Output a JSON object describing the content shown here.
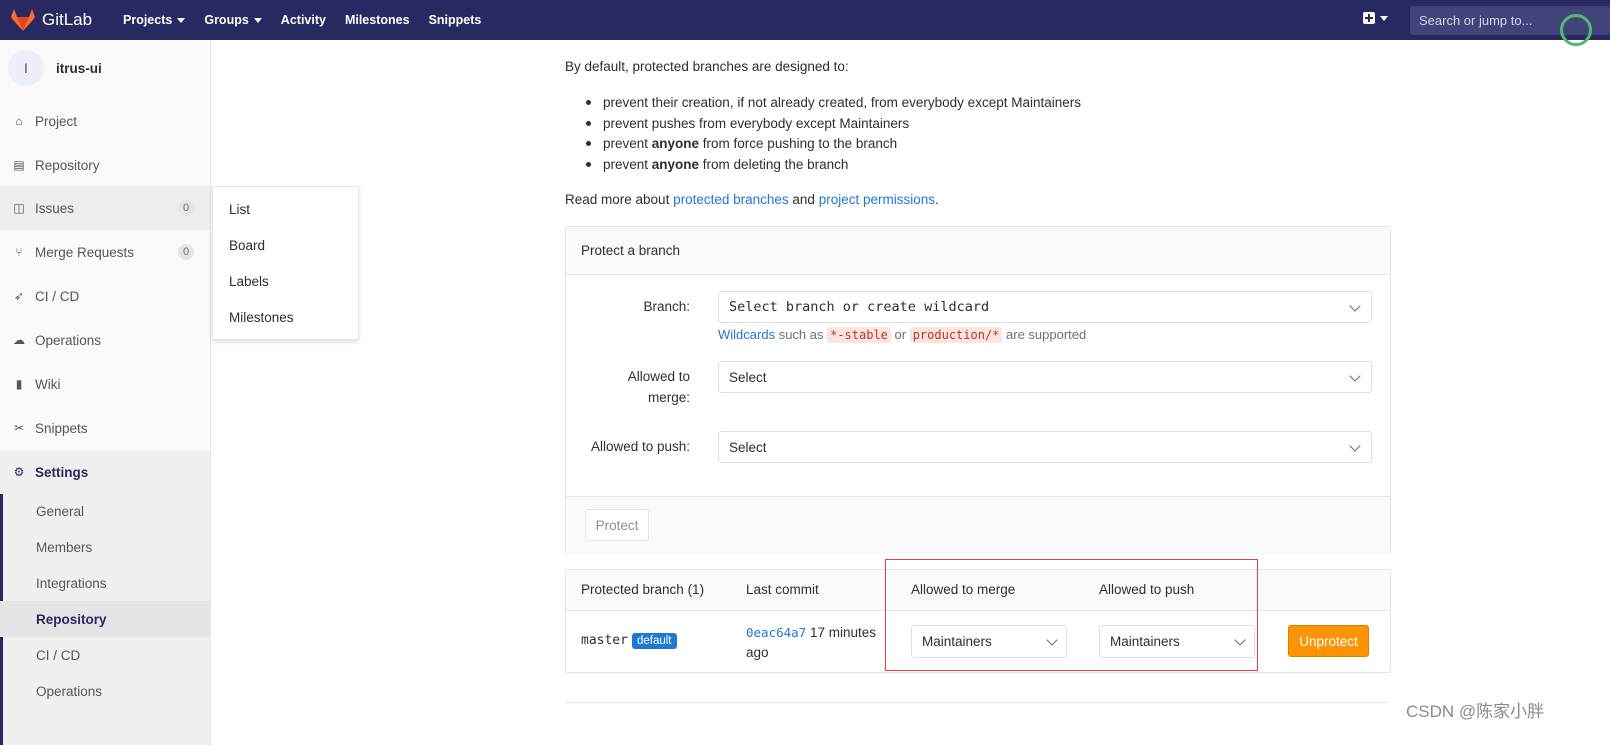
{
  "topbar": {
    "brand": "GitLab",
    "nav": [
      "Projects",
      "Groups",
      "Activity",
      "Milestones",
      "Snippets"
    ],
    "search_placeholder": "Search or jump to..."
  },
  "sidebar": {
    "project_initial": "I",
    "project_name": "itrus-ui",
    "items": [
      {
        "label": "Project"
      },
      {
        "label": "Repository"
      },
      {
        "label": "Issues",
        "count": "0"
      },
      {
        "label": "Merge Requests",
        "count": "0"
      },
      {
        "label": "CI / CD"
      },
      {
        "label": "Operations"
      },
      {
        "label": "Wiki"
      },
      {
        "label": "Snippets"
      },
      {
        "label": "Settings"
      }
    ],
    "settings_sub": [
      "General",
      "Members",
      "Integrations",
      "Repository",
      "CI / CD",
      "Operations"
    ]
  },
  "issues_flyout": [
    "List",
    "Board",
    "Labels",
    "Milestones"
  ],
  "intro": {
    "lead": "By default, protected branches are designed to:",
    "bullets": [
      {
        "pre": "prevent their creation, if not already created, from everybody except Maintainers",
        "bold": "",
        "post": ""
      },
      {
        "pre": "prevent pushes from everybody except Maintainers",
        "bold": "",
        "post": ""
      },
      {
        "pre": "prevent ",
        "bold": "anyone",
        "post": " from force pushing to the branch"
      },
      {
        "pre": "prevent ",
        "bold": "anyone",
        "post": " from deleting the branch"
      }
    ],
    "read_more_pre": "Read more about ",
    "link1": "protected branches",
    "and": " and ",
    "link2": "project permissions",
    "end": "."
  },
  "protect_panel": {
    "title": "Protect a branch",
    "branch_label": "Branch:",
    "branch_placeholder": "Select branch or create wildcard",
    "hint_link": "Wildcards",
    "hint_such": " such as ",
    "hint_code1": "*-stable",
    "hint_or": " or ",
    "hint_code2": "production/*",
    "hint_end": " are supported",
    "merge_label_1": "Allowed to",
    "merge_label_2": "merge:",
    "merge_value": "Select",
    "push_label": "Allowed to push:",
    "push_value": "Select",
    "protect_button": "Protect"
  },
  "protected_table": {
    "headers": [
      "Protected branch (1)",
      "Last commit",
      "Allowed to merge",
      "Allowed to push"
    ],
    "row": {
      "branch": "master",
      "badge": "default",
      "sha": "0eac64a7",
      "time_1": "17 minutes",
      "time_2": "ago",
      "merge": "Maintainers",
      "push": "Maintainers",
      "unprotect": "Unprotect"
    }
  },
  "watermark": "CSDN @陈家小胖",
  "colors": {
    "nav_bg": "#292961",
    "link": "#1f78d1",
    "unprotect": "#fc9403",
    "highlight_box": "#e84040"
  }
}
